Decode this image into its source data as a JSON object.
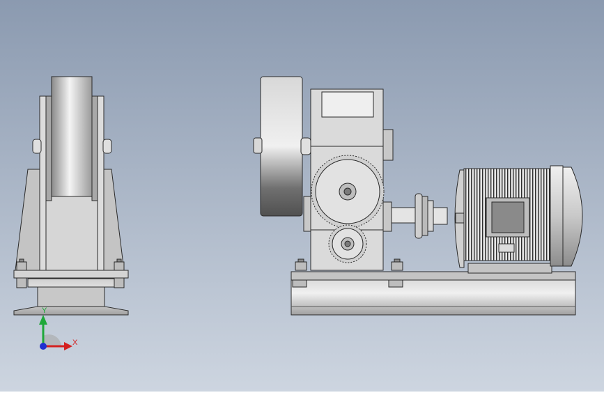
{
  "viewport": {
    "background_top": "#8b9ab0",
    "background_bottom": "#cdd5e0"
  },
  "triad": {
    "y_label": "Y",
    "x_label": "X",
    "y_color": "#1fa83a",
    "x_color": "#d42020",
    "z_color": "#2030d0"
  },
  "parts": {
    "metal_light": "#e8e8e8",
    "metal_mid": "#b8b8b8",
    "metal_dark": "#6e6e6e",
    "outline": "#2a2a2a",
    "motor_fin": "#3a3a3a"
  }
}
